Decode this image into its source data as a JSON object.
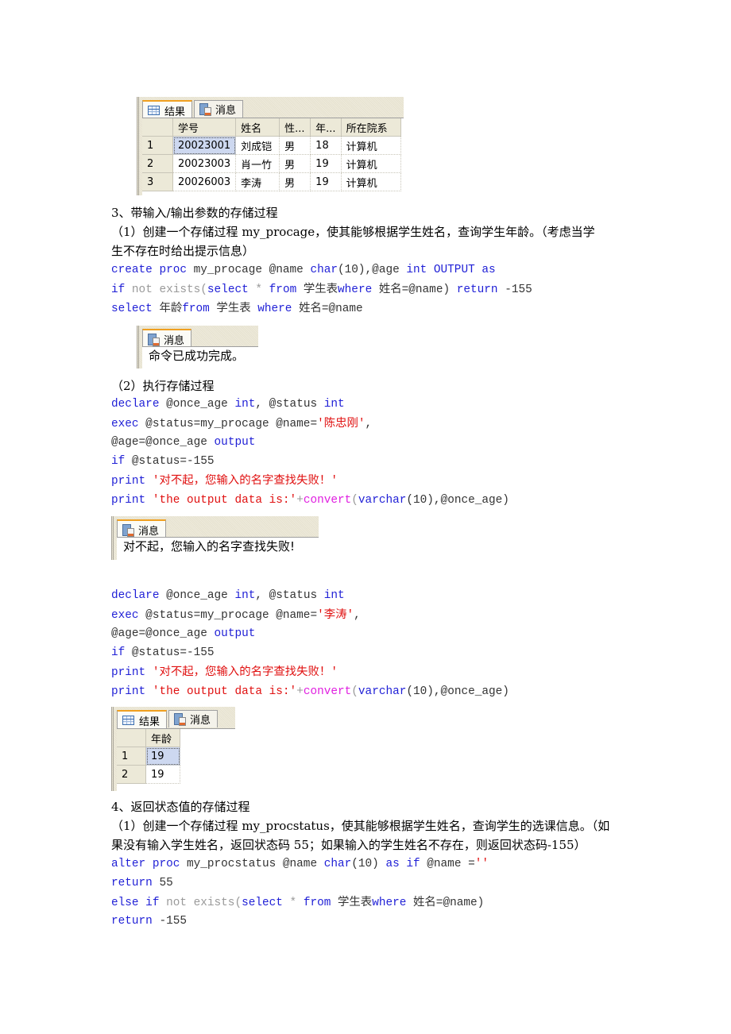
{
  "results_panel_1": {
    "tabs": [
      {
        "label": "结果",
        "icon": "grid-icon",
        "active": true
      },
      {
        "label": "消息",
        "icon": "message-icon",
        "active": false
      }
    ],
    "columns": [
      "学号",
      "姓名",
      "性...",
      "年...",
      "所在院系"
    ],
    "rows": [
      {
        "n": "1",
        "cells": [
          "20023001",
          "刘成铠",
          "男",
          "18",
          "计算机"
        ]
      },
      {
        "n": "2",
        "cells": [
          "20023003",
          "肖一竹",
          "男",
          "19",
          "计算机"
        ]
      },
      {
        "n": "3",
        "cells": [
          "20026003",
          "李涛",
          "男",
          "19",
          "计算机"
        ]
      }
    ]
  },
  "section3": {
    "heading": "3、带输入/输出参数的存储过程",
    "task1_line1": "（1）创建一个存储过程 my_procage，使其能够根据学生姓名，查询学生年龄。（考虑当学",
    "task1_line2": "生不存在时给出提示信息）",
    "code1": {
      "l1": {
        "a": "create proc",
        "b": " my_procage @name ",
        "c": "char",
        "d": "(10),@age ",
        "e": "int OUTPUT as"
      },
      "l2": {
        "a": "if",
        "b": " not exists(",
        "c": "select",
        "d": " * ",
        "e": "from",
        "f": " 学生表",
        "g": "where",
        "h": " 姓名=@name) ",
        "i": "return",
        "j": " -155"
      },
      "l3": {
        "a": "select",
        "b": " 年龄",
        "c": "from",
        "d": " 学生表 ",
        "e": "where",
        "f": " 姓名=@name"
      }
    },
    "message_panel_1": {
      "tab": "消息",
      "text": "命令已成功完成。"
    },
    "task2": "（2）执行存储过程",
    "exec1": {
      "l1": {
        "a": "declare",
        "b": " @once_age ",
        "c": "int",
        "d": ", @status ",
        "e": "int"
      },
      "l2": {
        "a": "exec",
        "b": " @status=my_procage @name=",
        "c": "'陈忠刚'",
        "d": ","
      },
      "l3": {
        "a": "@age=@once_age ",
        "b": "output"
      },
      "l4": {
        "a": "if",
        "b": " @status=-155"
      },
      "l5": {
        "a": "print",
        "b": " ",
        "c": "'对不起，您输入的名字查找失败！'"
      },
      "l6": {
        "a": "print",
        "b": " ",
        "c": "'the output data is:'",
        "d": "+",
        "e": "convert",
        "f": "(",
        "g": "varchar",
        "h": "(10),@once_age)"
      }
    },
    "message_panel_2": {
      "tab": "消息",
      "text": "对不起，您输入的名字查找失败!"
    },
    "exec2": {
      "l1": {
        "a": "declare",
        "b": " @once_age ",
        "c": "int",
        "d": ", @status ",
        "e": "int"
      },
      "l2": {
        "a": "exec",
        "b": " @status=my_procage @name=",
        "c": "'李涛'",
        "d": ","
      },
      "l3": {
        "a": "@age=@once_age ",
        "b": "output"
      },
      "l4": {
        "a": "if",
        "b": " @status=-155"
      },
      "l5": {
        "a": "print",
        "b": " ",
        "c": "'对不起，您输入的名字查找失败！'"
      },
      "l6": {
        "a": "print",
        "b": " ",
        "c": "'the output data is:'",
        "d": "+",
        "e": "convert",
        "f": "(",
        "g": "varchar",
        "h": "(10),@once_age)"
      }
    },
    "results_panel_2": {
      "tabs": [
        {
          "label": "结果"
        },
        {
          "label": "消息"
        }
      ],
      "columns": [
        "年龄"
      ],
      "rows": [
        {
          "n": "1",
          "cells": [
            "19"
          ]
        },
        {
          "n": "2",
          "cells": [
            "19"
          ]
        }
      ]
    }
  },
  "section4": {
    "heading": "4、返回状态值的存储过程",
    "task1_line1": "（1）创建一个存储过程 my_procstatus，使其能够根据学生姓名，查询学生的选课信息。（如",
    "task1_line2": "果没有输入学生姓名，返回状态码 55；如果输入的学生姓名不存在，则返回状态码-155）",
    "code": {
      "l1": {
        "a": "alter proc",
        "b": " my_procstatus @name ",
        "c": "char",
        "d": "(10) ",
        "e": "as if",
        "f": " @name =",
        "g": "''"
      },
      "l2": {
        "a": "return",
        "b": " 55"
      },
      "l3": {
        "a": "else if",
        "b": " not exists(",
        "c": "select",
        "d": " * ",
        "e": "from",
        "f": " 学生表",
        "g": "where",
        "h": " 姓名=@name)"
      },
      "l4": {
        "a": "return",
        "b": " -155"
      }
    }
  }
}
